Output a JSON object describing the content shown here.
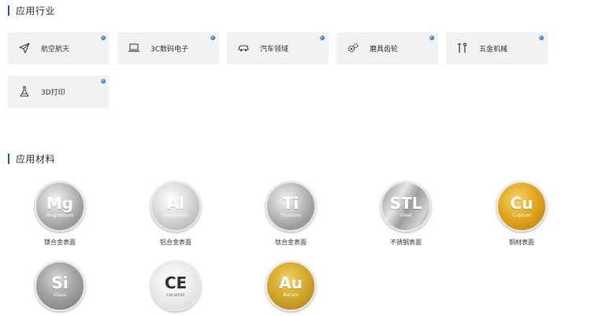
{
  "industries": {
    "title": "应用行业",
    "items": [
      {
        "label": "航空航天",
        "icon": "airplane-icon"
      },
      {
        "label": "3C数码电子",
        "icon": "laptop-icon"
      },
      {
        "label": "汽车领域",
        "icon": "car-icon"
      },
      {
        "label": "磨具齿轮",
        "icon": "gear-icon"
      },
      {
        "label": "五金机械",
        "icon": "tools-icon"
      },
      {
        "label": "3D打印",
        "icon": "flask-icon"
      }
    ],
    "dot_color": "#3f7fd0"
  },
  "materials": {
    "title": "应用材料",
    "items": [
      {
        "symbol": "Mg",
        "sub": "Magnesium",
        "label": "镁合金表面",
        "style": "silver"
      },
      {
        "symbol": "Al",
        "sub": "Aluminium",
        "label": "铝合金表面",
        "style": "light"
      },
      {
        "symbol": "Ti",
        "sub": "Titanium",
        "label": "钛合金表面",
        "style": "silver"
      },
      {
        "symbol": "STL",
        "sub": "Steel",
        "label": "不锈钢表面",
        "style": "steel"
      },
      {
        "symbol": "Cu",
        "sub": "Cuprum",
        "label": "铜材表面",
        "style": "copper"
      },
      {
        "symbol": "Si",
        "sub": "Glass",
        "label": "",
        "style": "glass"
      },
      {
        "symbol": "CE",
        "sub": "ceramic",
        "label": "",
        "style": "ceramic"
      },
      {
        "symbol": "Au",
        "sub": "Aurum",
        "label": "",
        "style": "gold"
      }
    ]
  },
  "colors": {
    "accent": "#1e5bb8",
    "card_bg": "#f2f2f2"
  }
}
